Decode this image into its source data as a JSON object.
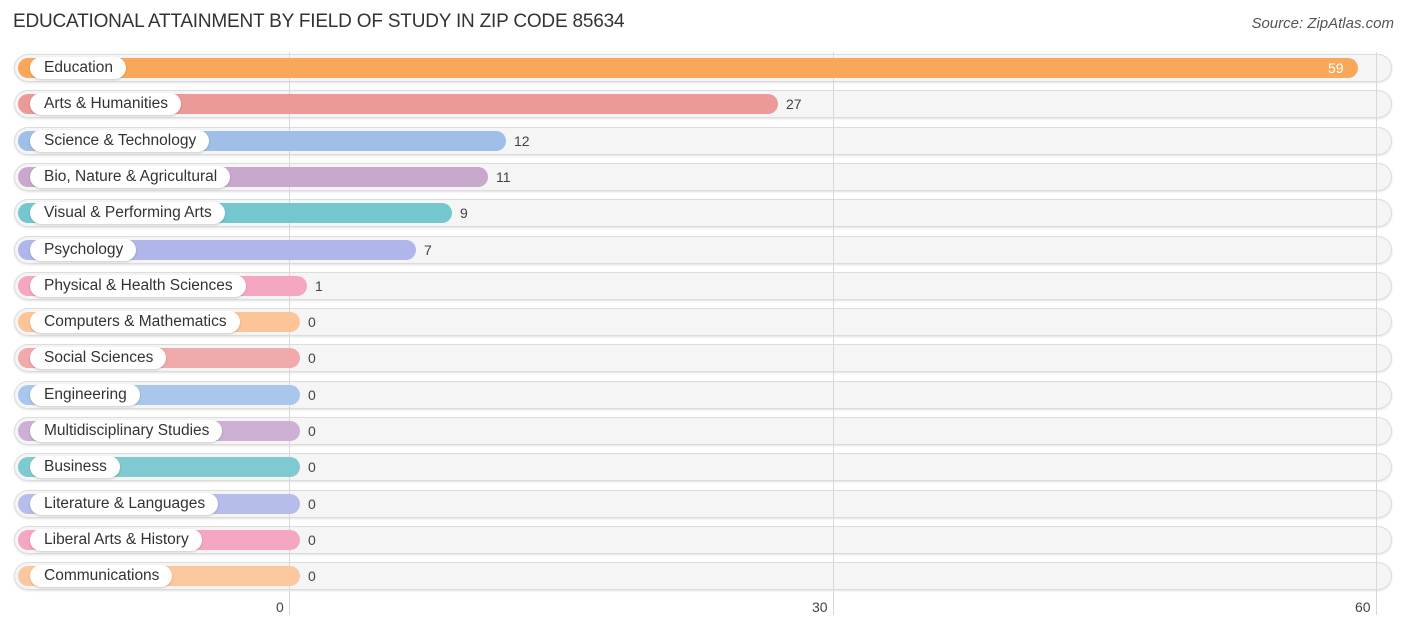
{
  "header": {
    "title": "EDUCATIONAL ATTAINMENT BY FIELD OF STUDY IN ZIP CODE 85634",
    "source": "Source: ZipAtlas.com"
  },
  "chart_data": {
    "type": "bar",
    "orientation": "horizontal",
    "title": "EDUCATIONAL ATTAINMENT BY FIELD OF STUDY IN ZIP CODE 85634",
    "source": "Source: ZipAtlas.com",
    "xlabel": "",
    "ylabel": "",
    "xlim": [
      0,
      60
    ],
    "xticks": [
      0,
      30,
      60
    ],
    "xtick_labels": [
      "0",
      "30",
      "60"
    ],
    "grid": true,
    "legend": "none",
    "categories": [
      "Education",
      "Arts & Humanities",
      "Science & Technology",
      "Bio, Nature & Agricultural",
      "Visual & Performing Arts",
      "Psychology",
      "Physical & Health Sciences",
      "Computers & Mathematics",
      "Social Sciences",
      "Engineering",
      "Multidisciplinary Studies",
      "Business",
      "Literature & Languages",
      "Liberal Arts & History",
      "Communications"
    ],
    "values": [
      59,
      27,
      12,
      11,
      9,
      7,
      1,
      0,
      0,
      0,
      0,
      0,
      0,
      0,
      0
    ],
    "colors": [
      "#f9a85b",
      "#ec9a98",
      "#9fbfe8",
      "#c8a8cc",
      "#74c6cf",
      "#b0b6ea",
      "#f5a6c0",
      "#fbc598",
      "#f0aaac",
      "#a9c6ec",
      "#cdb0d4",
      "#7fcad0",
      "#b6bdea",
      "#f5a6c3",
      "#fbc89e"
    ]
  }
}
